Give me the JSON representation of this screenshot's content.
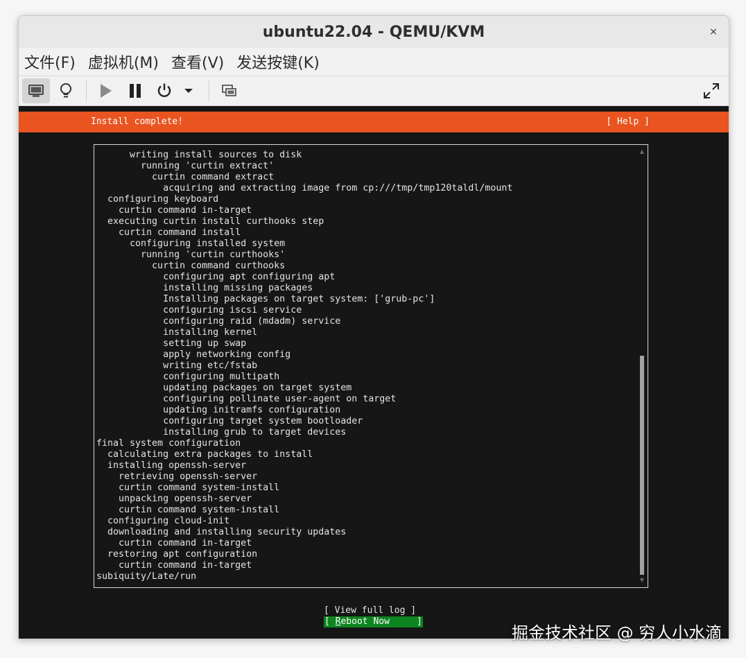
{
  "window": {
    "title": "ubuntu22.04 - QEMU/KVM",
    "close_glyph": "×"
  },
  "menubar": {
    "items": [
      "文件(F)",
      "虚拟机(M)",
      "查看(V)",
      "发送按键(K)"
    ]
  },
  "toolbar": {
    "icons": [
      "monitor-icon",
      "lightbulb-icon",
      "play-icon",
      "pause-icon",
      "power-icon",
      "dropdown-arrow-icon",
      "screenshot-icon",
      "fullscreen-icon"
    ]
  },
  "installer": {
    "status": "Install complete!",
    "help": "[ Help ]",
    "log_lines": [
      "      writing install sources to disk",
      "        running 'curtin extract'",
      "          curtin command extract",
      "            acquiring and extracting image from cp:///tmp/tmp120taldl/mount",
      "  configuring keyboard",
      "    curtin command in-target",
      "  executing curtin install curthooks step",
      "    curtin command install",
      "      configuring installed system",
      "        running 'curtin curthooks'",
      "          curtin command curthooks",
      "            configuring apt configuring apt",
      "            installing missing packages",
      "            Installing packages on target system: ['grub-pc']",
      "            configuring iscsi service",
      "            configuring raid (mdadm) service",
      "            installing kernel",
      "            setting up swap",
      "            apply networking config",
      "            writing etc/fstab",
      "            configuring multipath",
      "            updating packages on target system",
      "            configuring pollinate user-agent on target",
      "            updating initramfs configuration",
      "            configuring target system bootloader",
      "            installing grub to target devices",
      "final system configuration",
      "  calculating extra packages to install",
      "  installing openssh-server",
      "    retrieving openssh-server",
      "    curtin command system-install",
      "    unpacking openssh-server",
      "    curtin command system-install",
      "  configuring cloud-init",
      "  downloading and installing security updates",
      "    curtin command in-target",
      "  restoring apt configuration",
      "    curtin command in-target",
      "subiquity/Late/run"
    ],
    "view_log_label": "[ View full log ]",
    "reboot_prefix": "[ ",
    "reboot_hotkey": "R",
    "reboot_rest": "eboot Now     ]"
  },
  "watermark": "掘金技术社区 @ 穷人小水滴"
}
